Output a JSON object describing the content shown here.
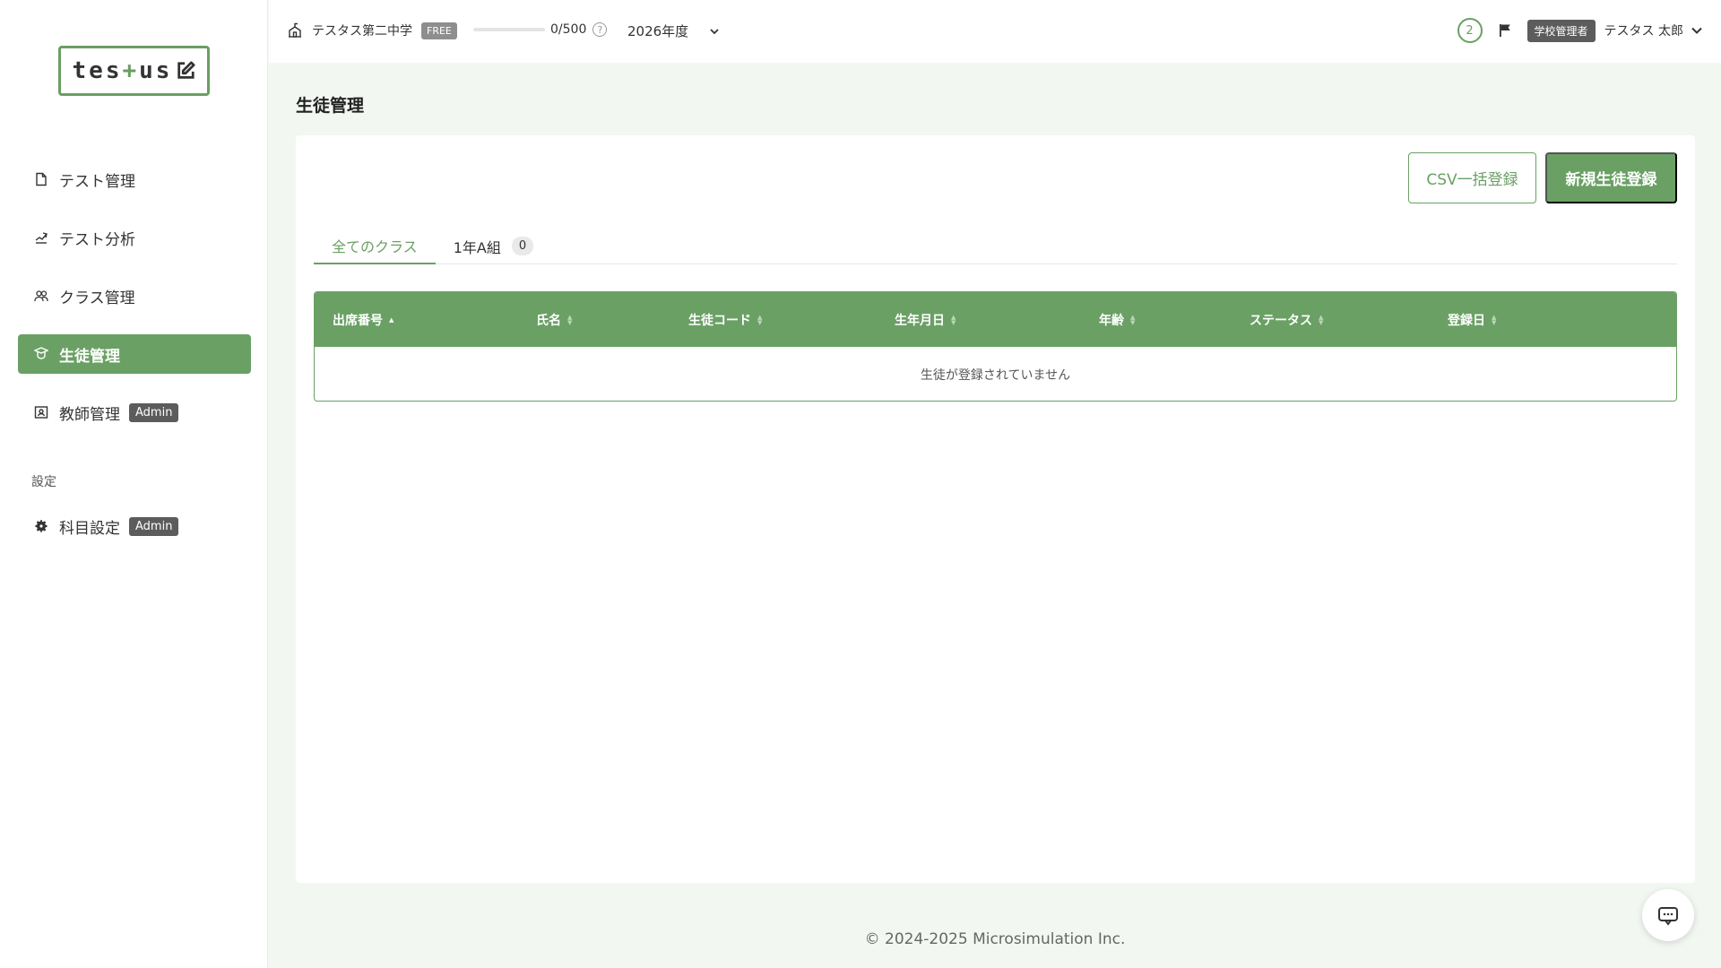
{
  "logo": {
    "part1": "tes",
    "plus": "+",
    "part2": "us"
  },
  "sidebar": {
    "items": [
      {
        "label": "テスト管理",
        "icon": "document-icon"
      },
      {
        "label": "テスト分析",
        "icon": "chart-icon"
      },
      {
        "label": "クラス管理",
        "icon": "group-icon"
      },
      {
        "label": "生徒管理",
        "icon": "student-icon",
        "active": true
      },
      {
        "label": "教師管理",
        "icon": "teacher-icon",
        "badge": "Admin"
      }
    ],
    "section_label": "設定",
    "settings_items": [
      {
        "label": "科目設定",
        "icon": "gear-icon",
        "badge": "Admin"
      }
    ]
  },
  "topbar": {
    "school_name": "テスタス第二中学",
    "plan_badge": "FREE",
    "quota_text": "0/500",
    "quota_fraction": 0,
    "year": "2026年度",
    "notification_count": "2",
    "role_badge": "学校管理者",
    "user_name": "テスタス 太郎"
  },
  "main": {
    "title": "生徒管理",
    "csv_button": "CSV一括登録",
    "new_button": "新規生徒登録",
    "tabs": [
      {
        "label": "全てのクラス",
        "active": true
      },
      {
        "label": "1年A組",
        "count": "0"
      }
    ],
    "table": {
      "columns": [
        "出席番号",
        "氏名",
        "生徒コード",
        "生年月日",
        "年齢",
        "ステータス",
        "登録日"
      ],
      "empty_text": "生徒が登録されていません"
    }
  },
  "footer": {
    "copyright": "© 2024-2025 Microsimulation Inc."
  },
  "colors": {
    "accent": "#6aa064",
    "background": "#f3f7f2"
  }
}
